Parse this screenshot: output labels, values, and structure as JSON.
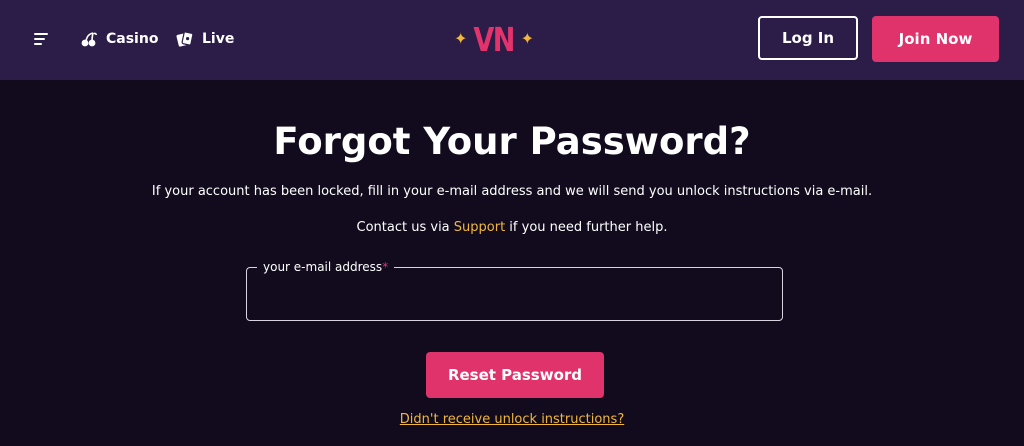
{
  "header": {
    "nav": [
      {
        "label": "Casino",
        "icon": "cherries-icon"
      },
      {
        "label": "Live",
        "icon": "playing-cards-icon"
      }
    ],
    "logo": {
      "text": "VN",
      "icon": "sparkle-star-icon"
    },
    "login_label": "Log In",
    "join_label": "Join Now"
  },
  "main": {
    "title": "Forgot Your Password?",
    "subtitle": "If your account has been locked, fill in your e-mail address and we will send you unlock instructions via e-mail.",
    "contact_prefix": "Contact us via ",
    "contact_link": "Support",
    "contact_suffix": " if you need further help.",
    "email_label": "your e-mail address",
    "email_required_mark": "*",
    "email_value": "",
    "reset_label": "Reset Password",
    "unlock_link": "Didn't receive unlock instructions?"
  },
  "colors": {
    "header_bg": "#2c1d48",
    "page_bg": "#110b1d",
    "accent_pink": "#e0336b",
    "accent_gold": "#f1b73d"
  }
}
